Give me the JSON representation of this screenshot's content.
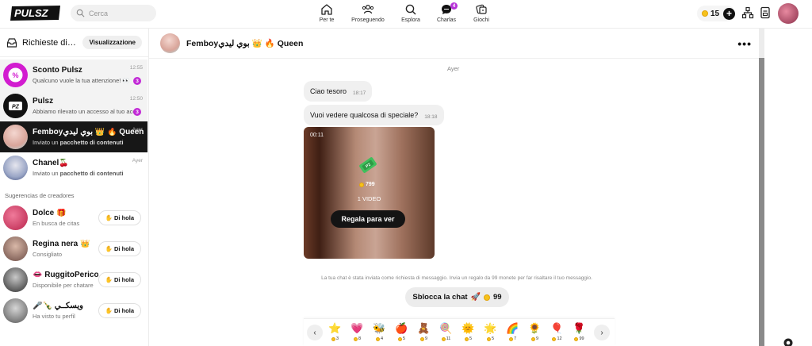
{
  "header": {
    "logo_text": "PULSZ",
    "search_placeholder": "Cerca",
    "nav": [
      {
        "label": "Per te",
        "icon": "home-icon"
      },
      {
        "label": "Proseguendo",
        "icon": "people-icon"
      },
      {
        "label": "Esplora",
        "icon": "search-icon"
      },
      {
        "label": "Charlas",
        "icon": "chat-icon",
        "badge": "4"
      },
      {
        "label": "Giochi",
        "icon": "games-icon"
      }
    ],
    "coins": "15"
  },
  "sidebar": {
    "title": "Richieste di messaggi",
    "view_button": "Visualizzazione",
    "conversations": [
      {
        "name": "Sconto Pulsz",
        "preview": "Qualcuno vuole la tua attenzione! 👀",
        "time": "12:55",
        "unread": "3"
      },
      {
        "name": "Pulsz",
        "preview": "Abbiamo rilevato un accesso al tuo account",
        "time": "12:50",
        "unread": "3"
      },
      {
        "name": "Femboyبوي ليدي 👑 🔥 Queen",
        "preview_prefix": "Inviato un ",
        "preview_bold": "pacchetto di contenuti",
        "time": "Ayer"
      },
      {
        "name": "Chanel🍒",
        "preview_prefix": "Inviato un ",
        "preview_bold": "pacchetto di contenuti",
        "time": "Ayer"
      }
    ],
    "suggestions_title": "Sugerencias de creadores",
    "suggestions": [
      {
        "name": "Dolce 🎁",
        "sub": "En busca de citas",
        "button": "Di hola"
      },
      {
        "name": "Regina nera 👑",
        "sub": "Consigliato",
        "button": "Di hola"
      },
      {
        "name": "👄 RuggitoPericoloso",
        "sub": "Disponibile per chatare",
        "button": "Di hola"
      },
      {
        "name": "🎤🍾 ويسكــي",
        "sub": "Ha visto tu perfil",
        "button": "Di hola"
      }
    ]
  },
  "chat": {
    "title": "Femboyبوي ليدي 👑 🔥 Queen",
    "day_label": "Ayer",
    "messages": [
      {
        "text": "Ciao tesoro",
        "time": "18:17"
      },
      {
        "text": "Vuoi vedere qualcosa di speciale?",
        "time": "18:18"
      }
    ],
    "media": {
      "duration": "00:11",
      "price": "799",
      "count": "1 VIDEO",
      "button": "Regala para ver"
    },
    "notice": "La tua chat è stata inviata come richiesta di messaggio. Invia un regalo da 99 monete per far risaltare il tuo messaggio.",
    "unlock": {
      "label": "Sblocca la chat",
      "price": "99"
    },
    "gifts": [
      {
        "icon": "⭐",
        "price": "3"
      },
      {
        "icon": "💗",
        "price": "8"
      },
      {
        "icon": "🐝",
        "price": "4"
      },
      {
        "icon": "🍎",
        "price": "5"
      },
      {
        "icon": "🧸",
        "price": "9"
      },
      {
        "icon": "🍭",
        "price": "11"
      },
      {
        "icon": "🌞",
        "price": "5"
      },
      {
        "icon": "🌟",
        "price": "5"
      },
      {
        "icon": "🌈",
        "price": "7"
      },
      {
        "icon": "🌻",
        "price": "9"
      },
      {
        "icon": "🎈",
        "price": "12"
      },
      {
        "icon": "🌹",
        "price": "99"
      }
    ]
  },
  "colors": {
    "accent": "#c22ad6",
    "coin": "#f6c21c",
    "dark": "#171717"
  }
}
